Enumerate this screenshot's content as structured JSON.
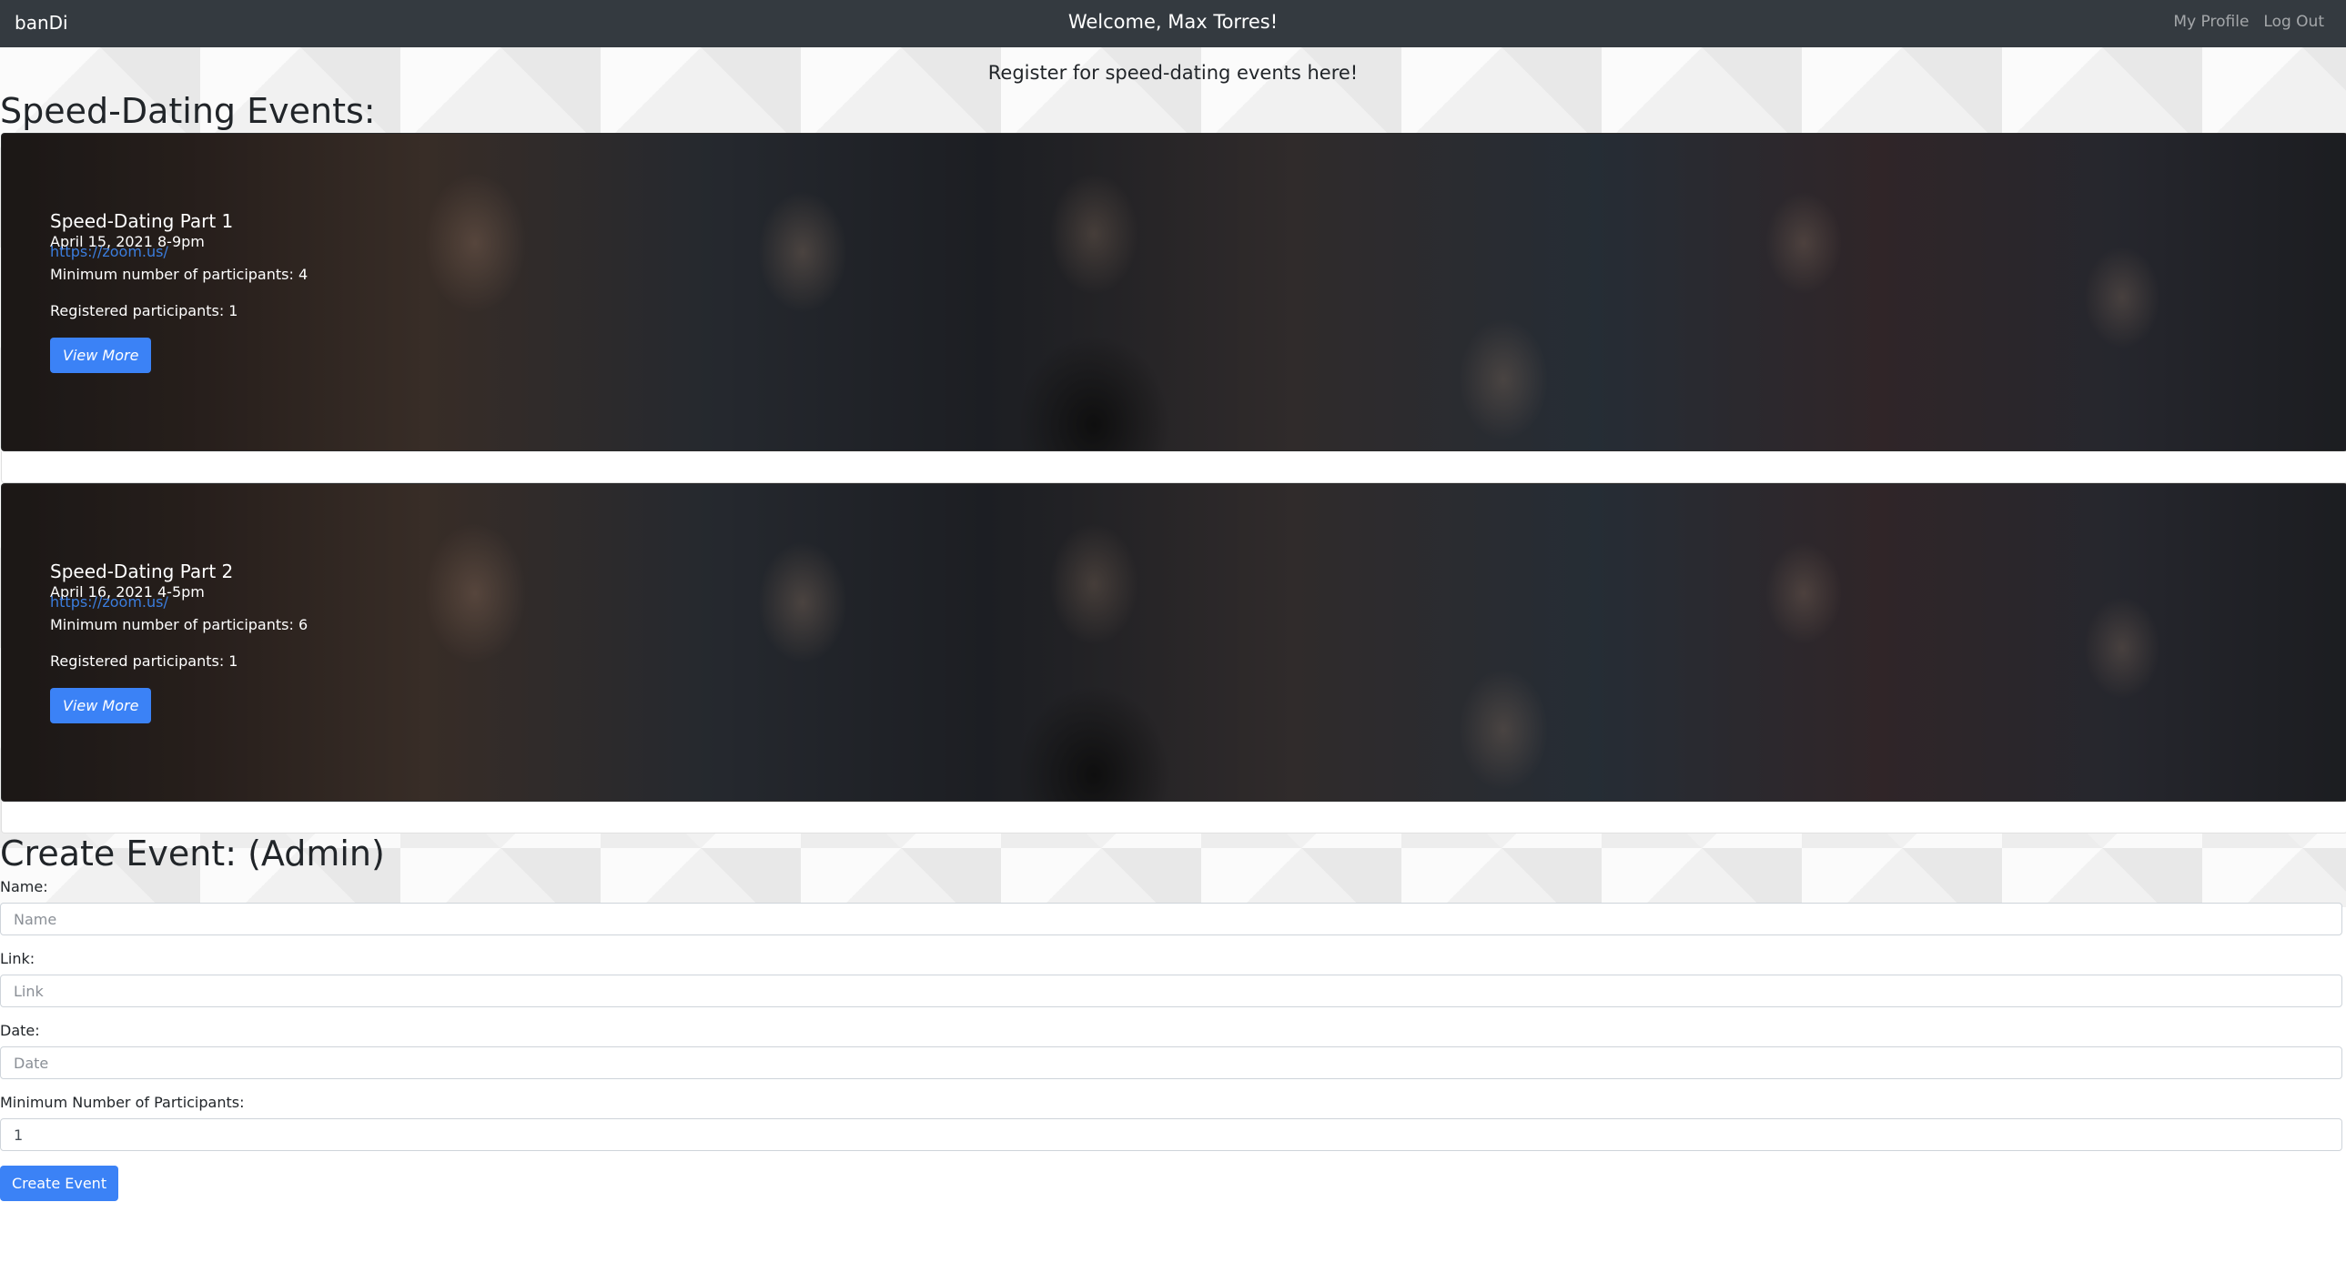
{
  "navbar": {
    "brand": "banDi",
    "welcome": "Welcome, Max Torres!",
    "links": [
      "My Profile",
      "Log Out"
    ]
  },
  "tagline": "Register for speed-dating events here!",
  "events_title": "Speed-Dating Events:",
  "events": [
    {
      "title": "Speed-Dating Part 1",
      "date": "April 15, 2021 8-9pm",
      "link": "https://zoom.us/",
      "min_participants": "Minimum number of participants: 4",
      "registered": "Registered participants: 1",
      "button": "View More"
    },
    {
      "title": "Speed-Dating Part 2",
      "date": "April 16, 2021 4-5pm",
      "link": "https://zoom.us/",
      "min_participants": "Minimum number of participants: 6",
      "registered": "Registered participants: 1",
      "button": "View More"
    }
  ],
  "create": {
    "title": "Create Event: (Admin)",
    "name_label": "Name:",
    "name_placeholder": "Name",
    "link_label": "Link:",
    "link_placeholder": "Link",
    "date_label": "Date:",
    "date_placeholder": "Date",
    "min_label": "Minimum Number of Participants:",
    "min_value": "1",
    "submit": "Create Event"
  },
  "colors": {
    "navbar": "#343a40",
    "primary": "#3b82f6",
    "link": "#3b7ddd"
  }
}
